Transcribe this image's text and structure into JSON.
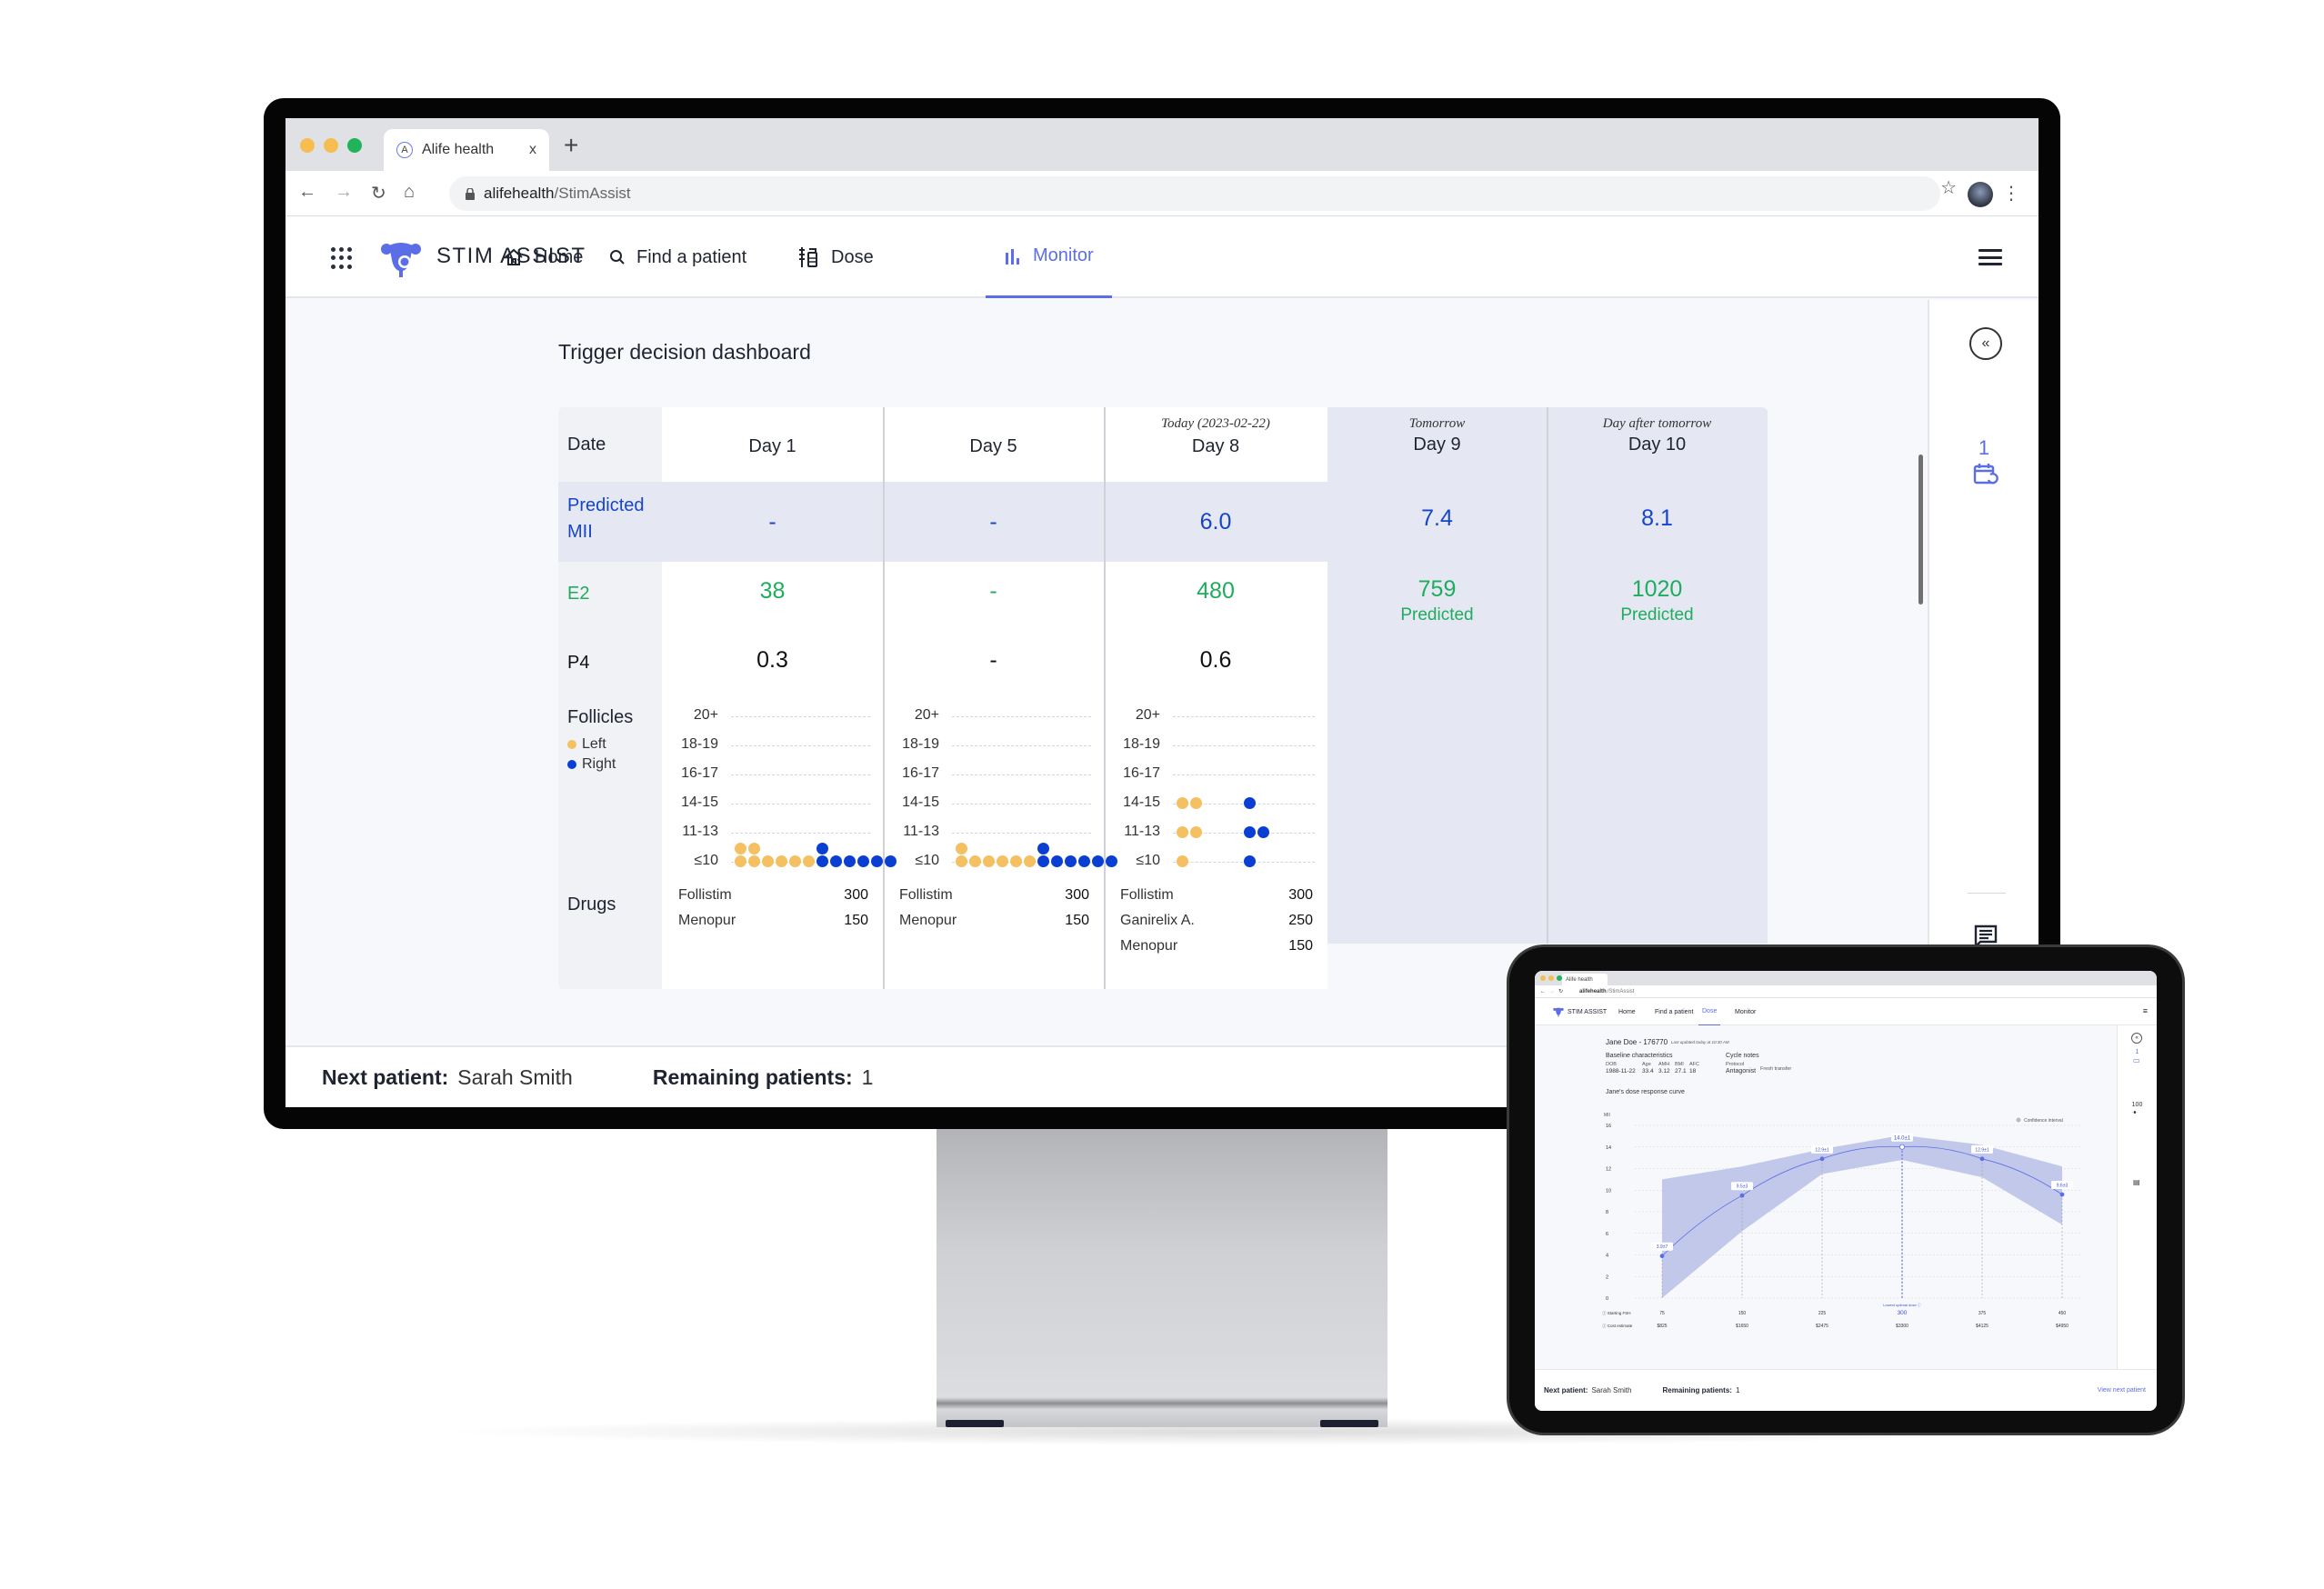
{
  "browser": {
    "tab_title": "Alife health",
    "tab_close": "x",
    "new_tab": "+",
    "url_host": "alifehealth",
    "url_path": "/StimAssist",
    "traffic_lights": [
      "#f6be50",
      "#f6be50",
      "#20b35a"
    ]
  },
  "app": {
    "brand": "STIM ASSIST",
    "accent": "#5b6ee8",
    "nav": [
      {
        "label": "Home",
        "icon": "home-icon"
      },
      {
        "label": "Find a patient",
        "icon": "search-icon"
      },
      {
        "label": "Dose",
        "icon": "syringe-vial-icon"
      },
      {
        "label": "Monitor",
        "icon": "bar-chart-icon",
        "active": true
      }
    ]
  },
  "dashboard": {
    "title": "Trigger decision dashboard",
    "row_labels": {
      "date": "Date",
      "predicted_mii": "Predicted MII",
      "e2": "E2",
      "p4": "P4",
      "follicles": "Follicles",
      "drugs": "Drugs"
    },
    "legend": {
      "left": "Left",
      "right": "Right",
      "left_color": "#f4c062",
      "right_color": "#0b3fd1"
    },
    "follicle_bins": [
      "20+",
      "18-19",
      "16-17",
      "14-15",
      "11-13",
      "≤10"
    ],
    "columns": [
      {
        "day": "Day 1",
        "sub": "",
        "forecast": false,
        "predicted_mii": "-",
        "e2": "38",
        "p4": "0.3",
        "follicles": {
          "≤10": {
            "left": 8,
            "right": 7
          }
        },
        "drugs": [
          {
            "name": "Follistim",
            "dose": "300"
          },
          {
            "name": "Menopur",
            "dose": "150"
          }
        ]
      },
      {
        "day": "Day 5",
        "sub": "",
        "forecast": false,
        "predicted_mii": "-",
        "e2": "-",
        "p4": "-",
        "follicles": {
          "≤10": {
            "left": 7,
            "right": 7
          }
        },
        "drugs": [
          {
            "name": "Follistim",
            "dose": "300"
          },
          {
            "name": "Menopur",
            "dose": "150"
          }
        ]
      },
      {
        "day": "Day 8",
        "sub": "Today (2023-02-22)",
        "forecast": false,
        "predicted_mii": "6.0",
        "e2": "480",
        "p4": "0.6",
        "follicles": {
          "14-15": {
            "left": 2,
            "right": 1
          },
          "11-13": {
            "left": 2,
            "right": 2
          },
          "≤10": {
            "left": 1,
            "right": 1
          }
        },
        "drugs": [
          {
            "name": "Follistim",
            "dose": "300"
          },
          {
            "name": "Ganirelix A.",
            "dose": "250"
          },
          {
            "name": "Menopur",
            "dose": "150"
          }
        ]
      },
      {
        "day": "Day 9",
        "sub": "Tomorrow",
        "forecast": true,
        "predicted_mii": "7.4",
        "e2": "759",
        "e2_note": "Predicted"
      },
      {
        "day": "Day 10",
        "sub": "Day after tomorrow",
        "forecast": true,
        "predicted_mii": "8.1",
        "e2": "1020",
        "e2_note": "Predicted"
      }
    ]
  },
  "rail": {
    "count": "1",
    "collapse": "«"
  },
  "footer": {
    "next_label": "Next patient:",
    "next_value": "Sarah Smith",
    "remaining_label": "Remaining patients:",
    "remaining_value": "1"
  },
  "tablet": {
    "tab_title": "Alife health",
    "url_host": "alifehealth",
    "url_path": "/StimAssist",
    "active_nav": "Dose",
    "patient": "Jane Doe - 176770",
    "last_updated": "Last updated today at 10:30 AM",
    "baseline_title": "Baseline characteristics",
    "baseline": [
      {
        "label": "DOB",
        "value": "1988-11-22"
      },
      {
        "label": "Age",
        "value": "33.4"
      },
      {
        "label": "AMH",
        "value": "3.12"
      },
      {
        "label": "BMI",
        "value": "27.1"
      },
      {
        "label": "AFC",
        "value": "18"
      }
    ],
    "cycle_title": "Cycle notes",
    "protocol_label": "Protocol",
    "protocol_value": "Antagonist",
    "cycle_note": "Fresh transfer",
    "rail_count": "1",
    "rail_patients": "100",
    "footer_next_label": "Next patient:",
    "footer_next_value": "Sarah Smith",
    "footer_remaining_label": "Remaining patients:",
    "footer_remaining_value": "1",
    "footer_link": "View next patient"
  },
  "chart_data": {
    "type": "line",
    "title": "Jane's dose response curve",
    "ylabel": "MII",
    "xlabel": "Starting FSH",
    "ylim": [
      0,
      16
    ],
    "yticks": [
      0,
      2,
      4,
      6,
      8,
      10,
      12,
      14,
      16
    ],
    "grid": true,
    "legend": {
      "entries": [
        "Confidence interval"
      ],
      "placement": "top-right"
    },
    "x": [
      75,
      150,
      225,
      300,
      375,
      450
    ],
    "categories": [
      "75",
      "150",
      "225",
      "300",
      "375",
      "450"
    ],
    "series": [
      {
        "name": "Predicted MII",
        "values": [
          3.9,
          9.5,
          12.9,
          14.0,
          12.9,
          9.6
        ],
        "labels": [
          "3.9±7",
          "9.5±3",
          "12.9±1",
          "14.0±1",
          "12.9±1",
          "9.6±3"
        ]
      }
    ],
    "confidence_interval": {
      "upper": [
        11.0,
        12.2,
        13.8,
        15.1,
        14.2,
        12.2
      ],
      "lower": [
        0.0,
        6.2,
        11.5,
        12.8,
        11.2,
        6.8
      ]
    },
    "highlight": {
      "x": 300,
      "label": "Lowest optimal dose"
    },
    "cost_label": "Cost estimate",
    "costs": [
      "$825",
      "$1650",
      "$2475",
      "$3300",
      "$4125",
      "$4950"
    ]
  }
}
